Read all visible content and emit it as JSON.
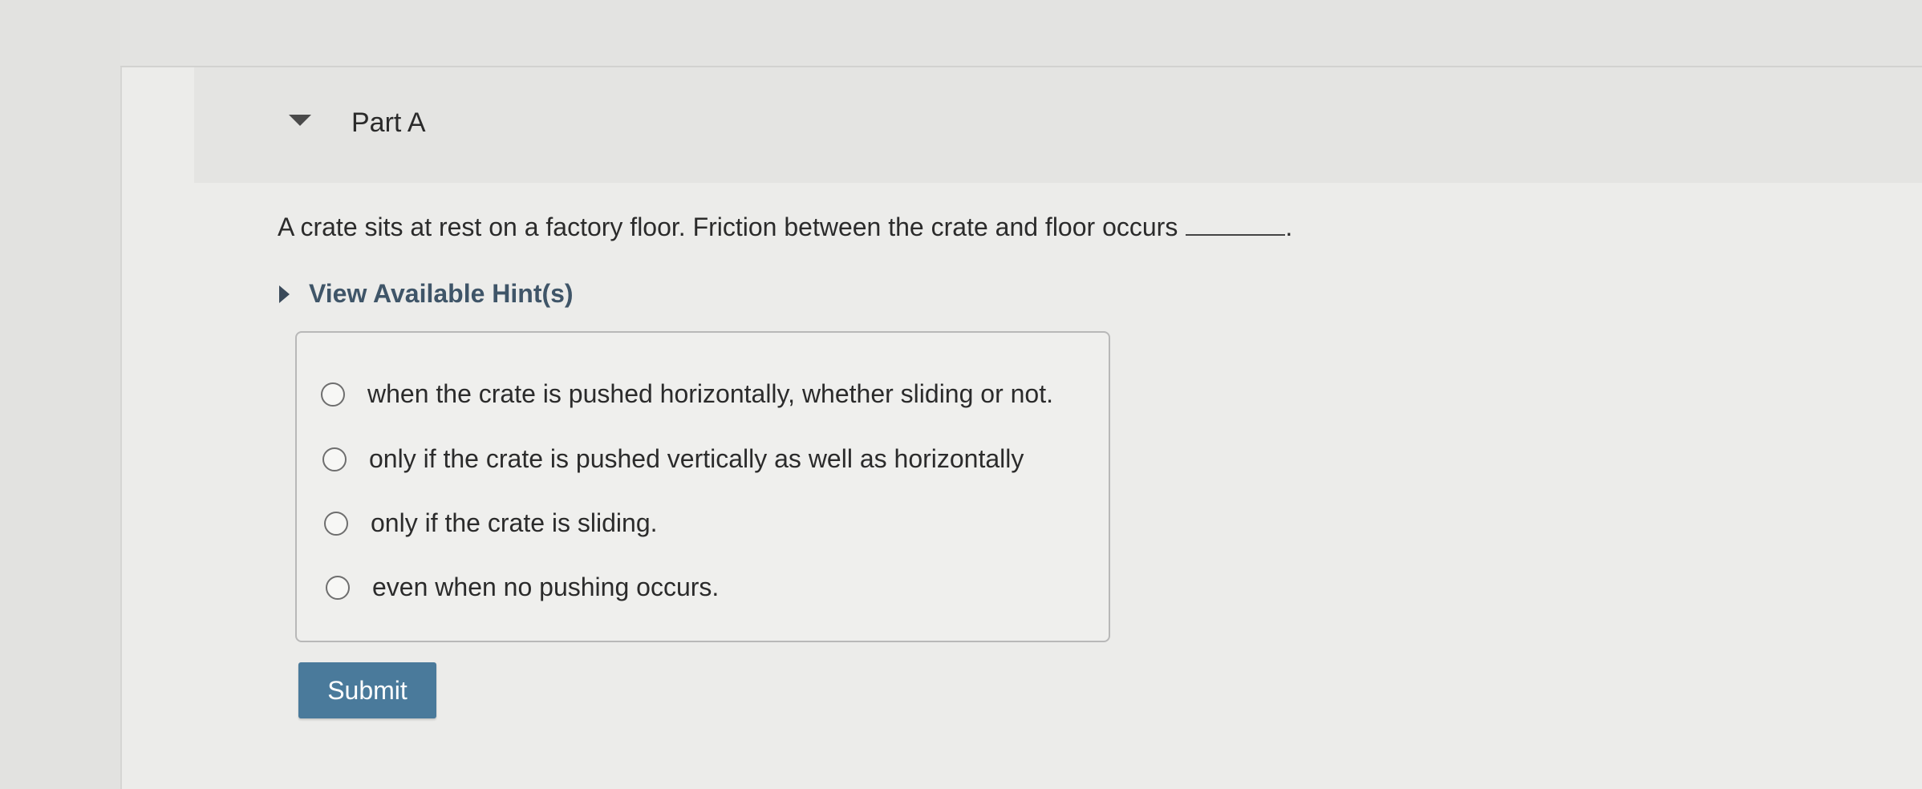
{
  "part": {
    "title": "Part A"
  },
  "question": {
    "text": "A crate sits at rest on a factory floor. Friction between the crate and floor occurs",
    "end_punctuation": "."
  },
  "hint": {
    "label": "View Available Hint(s)"
  },
  "options": [
    {
      "label": "when the crate is pushed horizontally, whether sliding or not."
    },
    {
      "label": "only if the crate is pushed vertically as well as horizontally"
    },
    {
      "label": "only if the crate is sliding."
    },
    {
      "label": "even when no pushing occurs."
    }
  ],
  "actions": {
    "submit_label": "Submit"
  },
  "colors": {
    "submit_background": "#4a7a9b",
    "hint_text": "#3f5568"
  },
  "icons": {
    "part_toggle": "caret-down-icon",
    "hint_toggle": "caret-right-icon"
  }
}
